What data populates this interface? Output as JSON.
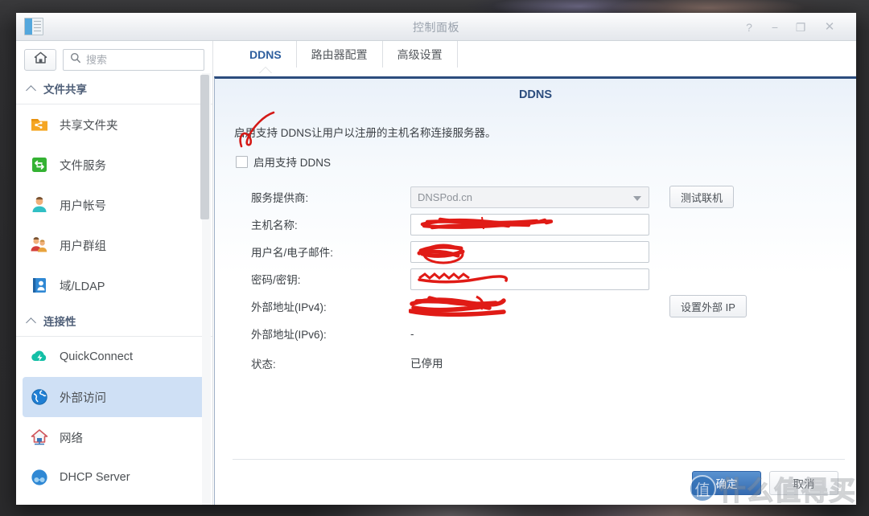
{
  "window": {
    "title": "控制面板",
    "icon": "control-panel-icon",
    "controls": [
      {
        "name": "help",
        "glyph": "?"
      },
      {
        "name": "minimize",
        "glyph": "−"
      },
      {
        "name": "maximize",
        "glyph": "❐"
      },
      {
        "name": "close",
        "glyph": "✕"
      }
    ]
  },
  "sidebar": {
    "home_button": "home-icon",
    "search": {
      "placeholder": "搜索",
      "value": ""
    },
    "groups": [
      {
        "label": "文件共享",
        "items": [
          {
            "label": "共享文件夹",
            "icon": "shared-folder-icon",
            "active": false
          },
          {
            "label": "文件服务",
            "icon": "file-service-icon",
            "active": false
          },
          {
            "label": "用户帐号",
            "icon": "user-account-icon",
            "active": false
          },
          {
            "label": "用户群组",
            "icon": "user-group-icon",
            "active": false
          },
          {
            "label": "域/LDAP",
            "icon": "domain-ldap-icon",
            "active": false
          }
        ]
      },
      {
        "label": "连接性",
        "items": [
          {
            "label": "QuickConnect",
            "icon": "quickconnect-icon",
            "active": false
          },
          {
            "label": "外部访问",
            "icon": "external-access-icon",
            "active": true
          },
          {
            "label": "网络",
            "icon": "network-icon",
            "active": false
          },
          {
            "label": "DHCP Server",
            "icon": "dhcp-server-icon",
            "active": false
          }
        ]
      }
    ]
  },
  "tabs": [
    {
      "label": "DDNS",
      "active": true
    },
    {
      "label": "路由器配置",
      "active": false
    },
    {
      "label": "高级设置",
      "active": false
    }
  ],
  "dialog": {
    "title": "DDNS",
    "description": "启用支持 DDNS让用户以注册的主机名称连接服务器。",
    "enable_checkbox": {
      "label": "启用支持 DDNS",
      "checked": false
    },
    "fields": [
      {
        "label": "服务提供商:",
        "type": "select",
        "value": "DNSPod.cn",
        "disabled": true,
        "action": "测试联机"
      },
      {
        "label": "主机名称:",
        "type": "text",
        "value": "",
        "redacted": true
      },
      {
        "label": "用户名/电子邮件:",
        "type": "text",
        "value": "",
        "redacted": true
      },
      {
        "label": "密码/密钥:",
        "type": "password",
        "value": "",
        "redacted": true
      },
      {
        "label": "外部地址(IPv4):",
        "type": "static",
        "value": "",
        "redacted": true,
        "action": "设置外部 IP"
      },
      {
        "label": "外部地址(IPv6):",
        "type": "static",
        "value": "-",
        "redacted": false
      },
      {
        "label": "状态:",
        "type": "static",
        "value": "已停用",
        "redacted": false
      }
    ],
    "footer": {
      "ok": "确定",
      "cancel": "取消"
    }
  },
  "annotations": {
    "checkmark_color": "#d41a17",
    "redaction_color": "#e01b16"
  },
  "watermark": {
    "badge": "值",
    "text": "什么值得买"
  },
  "colors": {
    "accent": "#2c4d7e",
    "primary_button": "#3a70b4",
    "active_nav": "#cfe0f5",
    "tab_active_text": "#2e5f9e"
  }
}
